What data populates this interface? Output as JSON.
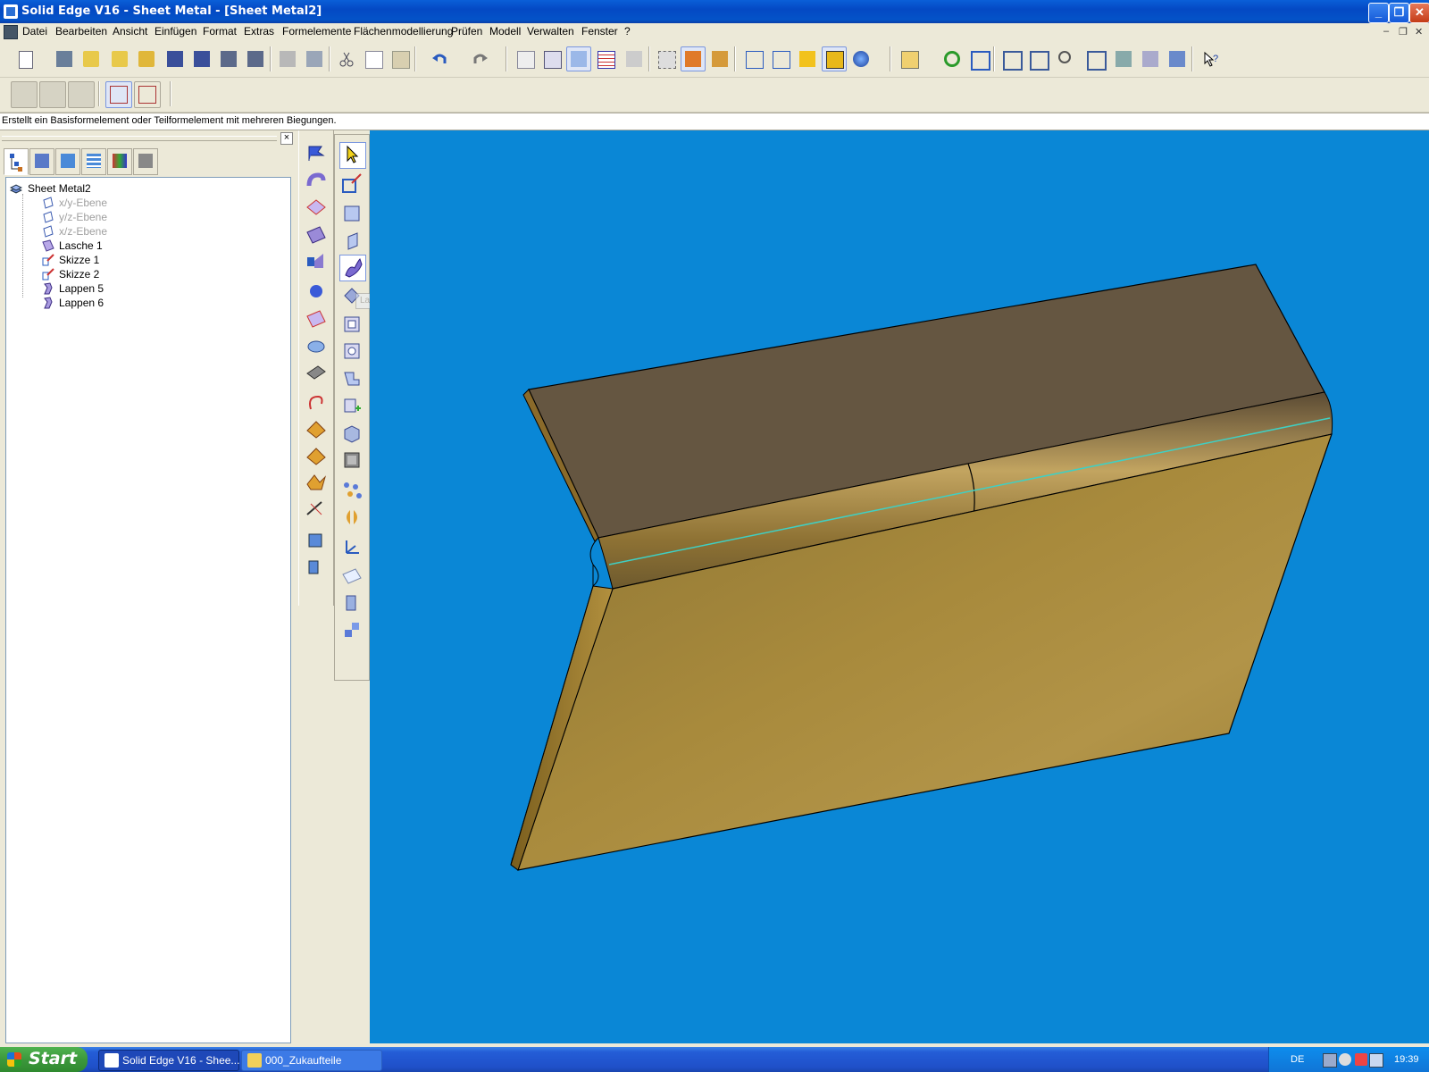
{
  "window": {
    "title": "Solid Edge V16 - Sheet Metal - [Sheet Metal2]",
    "controls": {
      "minimize": "_",
      "restore": "❐",
      "close": "✕"
    }
  },
  "menu": {
    "items": [
      "Datei",
      "Bearbeiten",
      "Ansicht",
      "Einfügen",
      "Format",
      "Extras",
      "Formelemente",
      "Flächenmodellierung",
      "Prüfen",
      "Modell",
      "Verwalten",
      "Fenster",
      "?"
    ],
    "mdi_controls": {
      "minimize": "–",
      "restore": "❐",
      "close": "✕"
    }
  },
  "toolbar": {
    "buttons": [
      "new-icon",
      "properties-icon",
      "open-icon",
      "open-folder-icon",
      "open-recent-icon",
      "save-icon",
      "save-as-icon",
      "save-all-icon",
      "save-copy-icon",
      "print-icon",
      "print-preview-icon",
      "cut-icon",
      "copy-icon",
      "paste-icon",
      "undo-icon",
      "redo-icon",
      "sketch-icon",
      "edit-sketch-icon",
      "sketch-view-icon",
      "table-icon",
      "select-tool-icon",
      "features-icon",
      "feature-library-icon",
      "feature-playback-icon",
      "wireframe-icon",
      "hidden-lines-icon",
      "shaded-icon",
      "shaded-visible-edges-icon",
      "render-icon",
      "zoom-area-icon",
      "refresh-icon",
      "fit-icon",
      "view-orient-icon",
      "zoom-icon",
      "zoom-in-icon",
      "fit-all-icon",
      "rotate-icon",
      "look-at-icon",
      "named-views-icon",
      "whats-this-icon"
    ]
  },
  "prompt": {
    "text": "Erstellt ein Basisformelement oder Teilformelement mit mehreren Biegungen."
  },
  "tree": {
    "root": "Sheet Metal2",
    "items": [
      {
        "label": "x/y-Ebene",
        "dim": true,
        "icon": "plane-icon"
      },
      {
        "label": "y/z-Ebene",
        "dim": true,
        "icon": "plane-icon"
      },
      {
        "label": "x/z-Ebene",
        "dim": true,
        "icon": "plane-icon"
      },
      {
        "label": "Lasche 1",
        "dim": false,
        "icon": "tab-feature-icon"
      },
      {
        "label": "Skizze 1",
        "dim": false,
        "icon": "sketch-icon"
      },
      {
        "label": "Skizze 2",
        "dim": false,
        "icon": "sketch-icon"
      },
      {
        "label": "Lappen 5",
        "dim": false,
        "icon": "contour-flange-icon"
      },
      {
        "label": "Lappen 6",
        "dim": false,
        "icon": "contour-flange-icon"
      }
    ]
  },
  "tooltip": {
    "text": "Lappen"
  },
  "taskbar": {
    "start_label": "Start",
    "tasks": [
      "Solid Edge V16 - Shee...",
      "000_Zukaufteile"
    ],
    "language": "DE",
    "clock": "19:39"
  },
  "colors": {
    "viewport_bg": "#0a87d6",
    "part_top": "#655641",
    "part_face": "#a88a3c",
    "selected_edge": "#3fd0c4"
  }
}
